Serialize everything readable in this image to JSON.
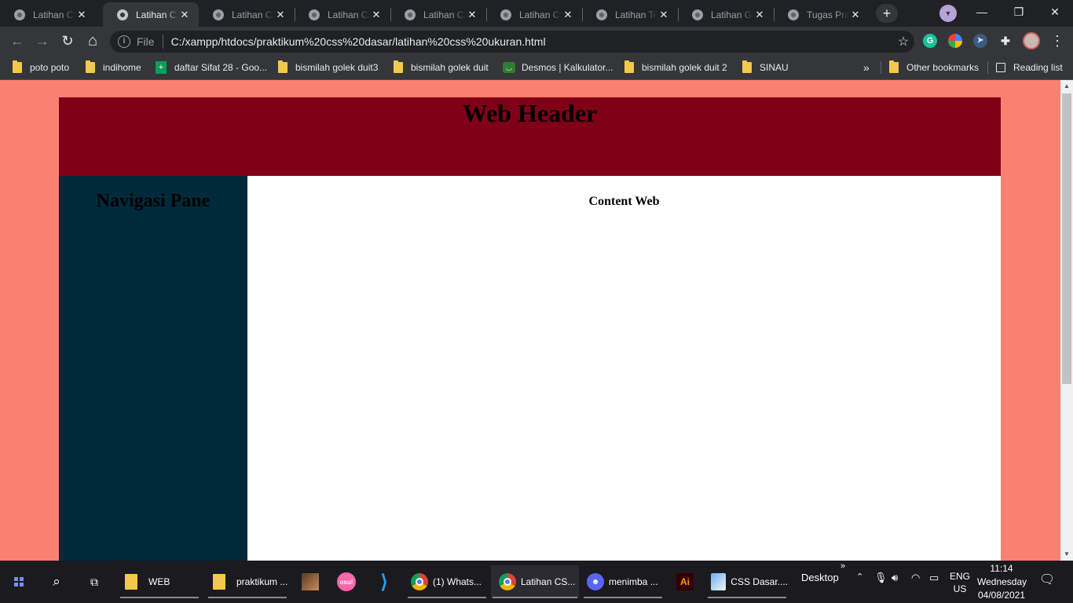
{
  "tabs": [
    {
      "title": "Latihan CSS"
    },
    {
      "title": "Latihan CSS"
    },
    {
      "title": "Latihan CSS"
    },
    {
      "title": "Latihan CSS"
    },
    {
      "title": "Latihan CSS"
    },
    {
      "title": "Latihan CSS"
    },
    {
      "title": "Latihan Teks"
    },
    {
      "title": "Latihan Gambar"
    },
    {
      "title": "Tugas Praktikum"
    }
  ],
  "active_tab_index": 1,
  "window_controls": {
    "minimize": "—",
    "maximize": "❐",
    "close": "✕"
  },
  "toolbar": {
    "back_icon": "←",
    "forward_icon": "→",
    "reload_icon": "↻",
    "home_icon": "⌂",
    "url_scheme_label": "File",
    "url": "C:/xampp/htdocs/praktikum%20css%20dasar/latihan%20css%20ukuran.html",
    "star_icon": "☆",
    "menu_icon": "⋮"
  },
  "bookmarks": [
    {
      "label": "poto poto",
      "icon": "folder-icon"
    },
    {
      "label": "indihome",
      "icon": "folder-icon"
    },
    {
      "label": "daftar Sifat 28 - Goo...",
      "icon": "sheets-icon"
    },
    {
      "label": "bismilah golek duit3",
      "icon": "folder-icon"
    },
    {
      "label": "bismilah golek duit",
      "icon": "folder-icon"
    },
    {
      "label": "Desmos | Kalkulator...",
      "icon": "desmos-icon"
    },
    {
      "label": "bismilah golek duit 2",
      "icon": "folder-icon"
    },
    {
      "label": "SINAU",
      "icon": "folder-icon"
    }
  ],
  "bookmarks_overflow": "»",
  "other_bookmarks": "Other bookmarks",
  "reading_list": "Reading list",
  "page": {
    "header_text": "Web Header",
    "nav_text": "Navigasi Pane",
    "content_text": "Content Web",
    "colors": {
      "background": "#fa8072",
      "header": "#800017",
      "nav": "#002a3a",
      "content": "#ffffff"
    }
  },
  "taskbar": {
    "items": [
      {
        "label": "WEB"
      },
      {
        "label": "praktikum ..."
      },
      {
        "label": "(1) Whats..."
      },
      {
        "label": "Latihan CS..."
      },
      {
        "label": "menimba ..."
      },
      {
        "label": "CSS Dasar...."
      }
    ],
    "desktop_label": "Desktop",
    "language": "ENG",
    "region": "US",
    "time": "11:14",
    "day": "Wednesday",
    "date": "04/08/2021",
    "osu_label": "osu!",
    "ai_label": "Ai"
  }
}
